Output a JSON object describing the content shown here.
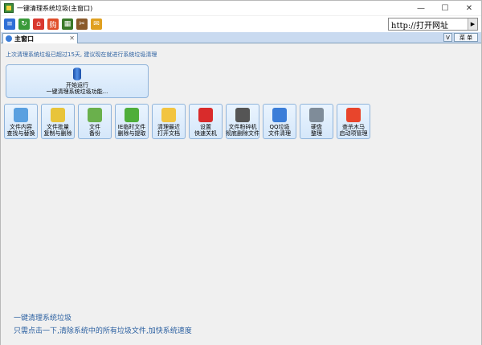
{
  "window": {
    "title": "一键清理系统垃圾(主窗口)",
    "controls": {
      "minimize": "—",
      "maximize": "☐",
      "close": "✕"
    }
  },
  "toolbar": {
    "icons": [
      {
        "name": "list-icon",
        "color": "#2f6fd6",
        "glyph": "≡"
      },
      {
        "name": "refresh-icon",
        "color": "#3a9a3a",
        "glyph": "↻"
      },
      {
        "name": "home-icon",
        "color": "#d9382f",
        "glyph": "⌂"
      },
      {
        "name": "shop-icon",
        "color": "#e04e2a",
        "glyph": "购"
      },
      {
        "name": "game-icon",
        "color": "#3a7a2a",
        "glyph": "▦"
      },
      {
        "name": "tools-icon",
        "color": "#8a5a2a",
        "glyph": "✂"
      },
      {
        "name": "chat-icon",
        "color": "#e0a020",
        "glyph": "✉"
      }
    ],
    "address": {
      "text": "http://打开网址",
      "go": "▶"
    }
  },
  "tabbar": {
    "tab_label": "主窗口",
    "tab_close": "✕",
    "collapse": "V",
    "menu_label": "菜 单"
  },
  "main": {
    "hint": "上次清理系统垃圾已超过15天, 建议现在就进行系统垃圾清理",
    "big_button": {
      "line1": "开始运行",
      "line2": "一键清理系统垃圾功能..."
    },
    "tiles": [
      {
        "name": "tile-file-content",
        "icon_color": "#5aa0e0",
        "l1": "文件内容",
        "l2": "查找与替换"
      },
      {
        "name": "tile-file-batch",
        "icon_color": "#e8c43a",
        "l1": "文件批量",
        "l2": "复制与删除"
      },
      {
        "name": "tile-file-backup",
        "icon_color": "#6ab04c",
        "l1": "文件",
        "l2": "备份"
      },
      {
        "name": "tile-ie-temp",
        "icon_color": "#4fae3a",
        "l1": "IE临时文件",
        "l2": "删除与提取"
      },
      {
        "name": "tile-recent-docs",
        "icon_color": "#f2c440",
        "l1": "清理最近",
        "l2": "打开文档"
      },
      {
        "name": "tile-shutdown",
        "icon_color": "#d92b2b",
        "l1": "设置",
        "l2": "快速关机"
      },
      {
        "name": "tile-shredder",
        "icon_color": "#555555",
        "l1": "文件粉碎机",
        "l2": "彻底删除文件"
      },
      {
        "name": "tile-qq-cleanup",
        "icon_color": "#3b7dd8",
        "l1": "QQ垃圾",
        "l2": "文件清理"
      },
      {
        "name": "tile-disk-defrag",
        "icon_color": "#7f8c99",
        "l1": "硬盘",
        "l2": "整理"
      },
      {
        "name": "tile-trojan-startup",
        "icon_color": "#e8452c",
        "l1": "查杀木马",
        "l2": "启动项管理"
      }
    ],
    "bottom_title": "一键清理系统垃圾",
    "bottom_desc": "只需点击一下,清除系统中的所有垃圾文件,加快系统速度"
  }
}
